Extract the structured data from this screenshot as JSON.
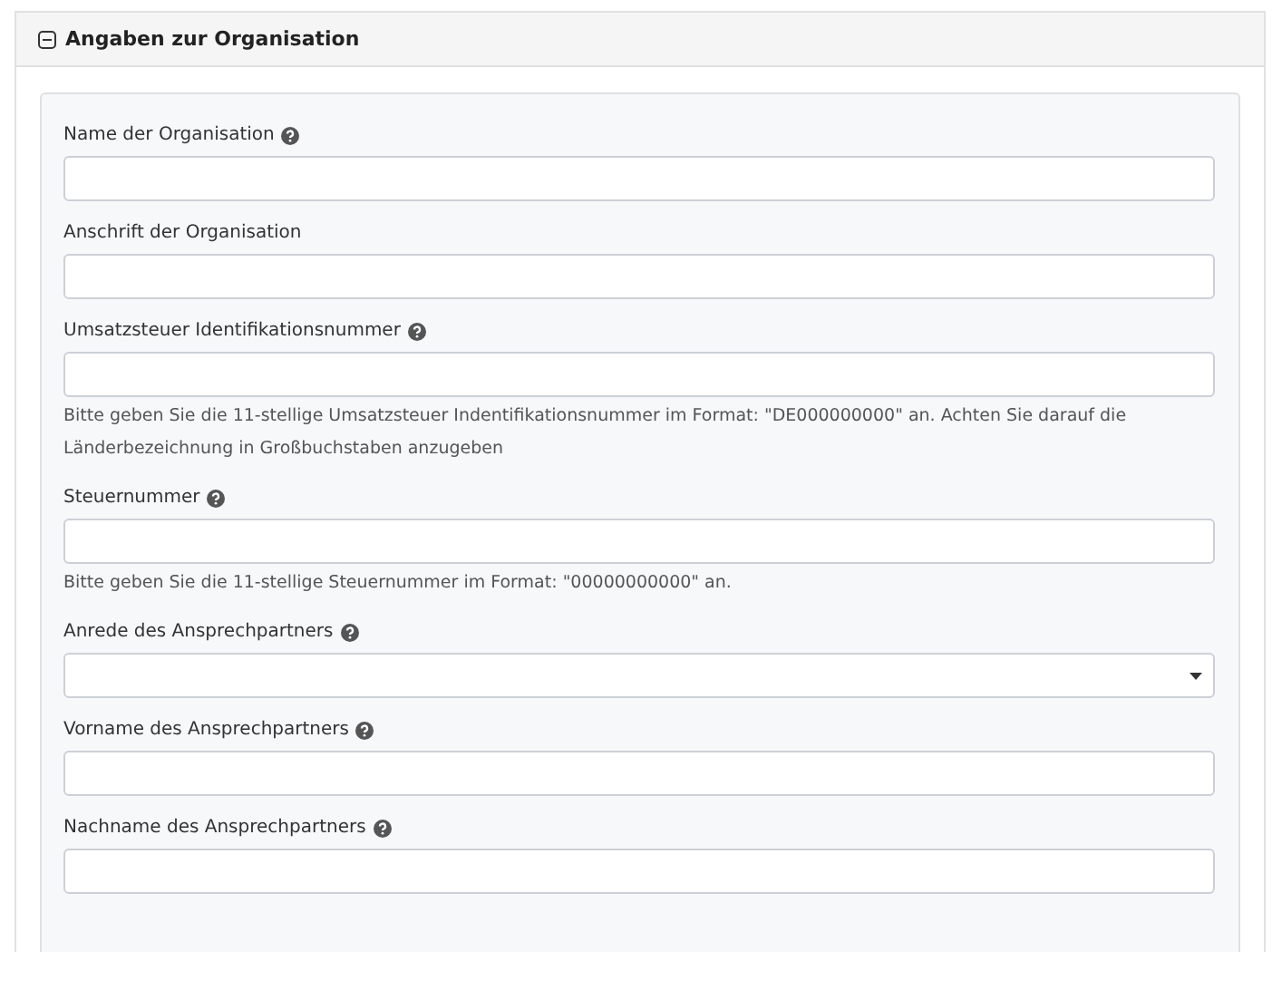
{
  "section": {
    "title": "Angaben zur Organisation",
    "expanded": true
  },
  "fields": [
    {
      "kind": "text",
      "label": "Name der Organisation",
      "help": true
    },
    {
      "kind": "text",
      "label": "Anschrift der Organisation",
      "help": false
    },
    {
      "kind": "text",
      "label": "Umsatzsteuer Identifikationsnummer",
      "help": true,
      "hint": "Bitte geben Sie die 11-stellige Umsatzsteuer Indentifikationsnummer im Format: \"DE000000000\" an. Achten Sie darauf die Länderbezeichnung in Großbuchstaben anzugeben"
    },
    {
      "kind": "text",
      "label": "Steuernummer",
      "help": true,
      "hint": "Bitte geben Sie die 11-stellige Steuernummer im Format: \"00000000000\" an."
    },
    {
      "kind": "select",
      "label": "Anrede des Ansprechpartners",
      "help": true
    },
    {
      "kind": "text",
      "label": "Vorname des Ansprechpartners",
      "help": true
    },
    {
      "kind": "text",
      "label": "Nachname des Ansprechpartners",
      "help": true
    }
  ]
}
